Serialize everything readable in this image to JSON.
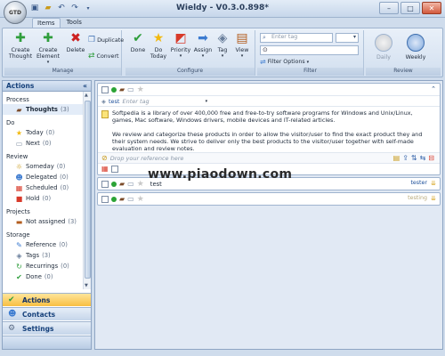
{
  "window": {
    "title": "Wieldy - V0.3.0.898*"
  },
  "ribbon_tabs": [
    "Items",
    "Tools"
  ],
  "ribbon": {
    "groups": {
      "manage": "Manage",
      "configure": "Configure",
      "filter": "Filter",
      "review": "Review"
    },
    "buttons": {
      "create_thought": "Create Thought",
      "create_element": "Create Element",
      "delete": "Delete",
      "duplicate": "Duplicate",
      "convert": "Convert",
      "done": "Done",
      "do_today": "Do Today",
      "priority": "Priority",
      "assign": "Assign",
      "tag": "Tag",
      "view": "View",
      "filter_options": "Filter Options",
      "daily": "Daily",
      "weekly": "Weekly"
    },
    "filter_placeholder": "Enter tag"
  },
  "left_panel": {
    "title": "Actions",
    "sections": [
      {
        "label": "Process",
        "items": [
          {
            "label": "Thoughts",
            "count": "(3)",
            "icon": "thoughts-icon",
            "selected": true
          }
        ]
      },
      {
        "label": "Do",
        "items": [
          {
            "label": "Today",
            "count": "(0)",
            "icon": "star-icon"
          },
          {
            "label": "Next",
            "count": "(0)",
            "icon": "next-icon"
          }
        ]
      },
      {
        "label": "Review",
        "items": [
          {
            "label": "Someday",
            "count": "(0)",
            "icon": "someday-icon"
          },
          {
            "label": "Delegated",
            "count": "(0)",
            "icon": "delegated-icon"
          },
          {
            "label": "Scheduled",
            "count": "(0)",
            "icon": "calendar-icon"
          },
          {
            "label": "Hold",
            "count": "(0)",
            "icon": "hold-icon"
          }
        ]
      },
      {
        "label": "Projects",
        "items": [
          {
            "label": "Not assigned",
            "count": "(3)",
            "icon": "project-icon"
          }
        ]
      },
      {
        "label": "Storage",
        "items": [
          {
            "label": "Reference",
            "count": "(0)",
            "icon": "reference-icon"
          },
          {
            "label": "Tags",
            "count": "(3)",
            "icon": "tag-icon"
          },
          {
            "label": "Recurrings",
            "count": "(0)",
            "icon": "recurring-icon"
          },
          {
            "label": "Done",
            "count": "(0)",
            "icon": "done-icon"
          }
        ]
      }
    ],
    "nav_buttons": [
      {
        "label": "Actions",
        "active": true
      },
      {
        "label": "Contacts",
        "active": false
      },
      {
        "label": "Settings",
        "active": false
      }
    ]
  },
  "main": {
    "expanded_item": {
      "tag": "test",
      "tag_placeholder": "Enter tag",
      "note_p1": "Softpedia is a library of over 400,000 free and free-to-try software programs for Windows and Unix/Linux, games, Mac software, Windows drivers, mobile devices and IT-related articles.",
      "note_p2": "We review and categorize these products in order to allow the visitor/user to find the exact product they and their system needs. We strive to deliver only the best products to the visitor/user together with self-made evaluation and review notes.",
      "reference_placeholder": "Drop your reference here"
    },
    "items": [
      {
        "title": "test",
        "tag": "tester"
      },
      {
        "title": "",
        "tag": "testing"
      }
    ]
  },
  "watermark": "www.piaodown.com"
}
